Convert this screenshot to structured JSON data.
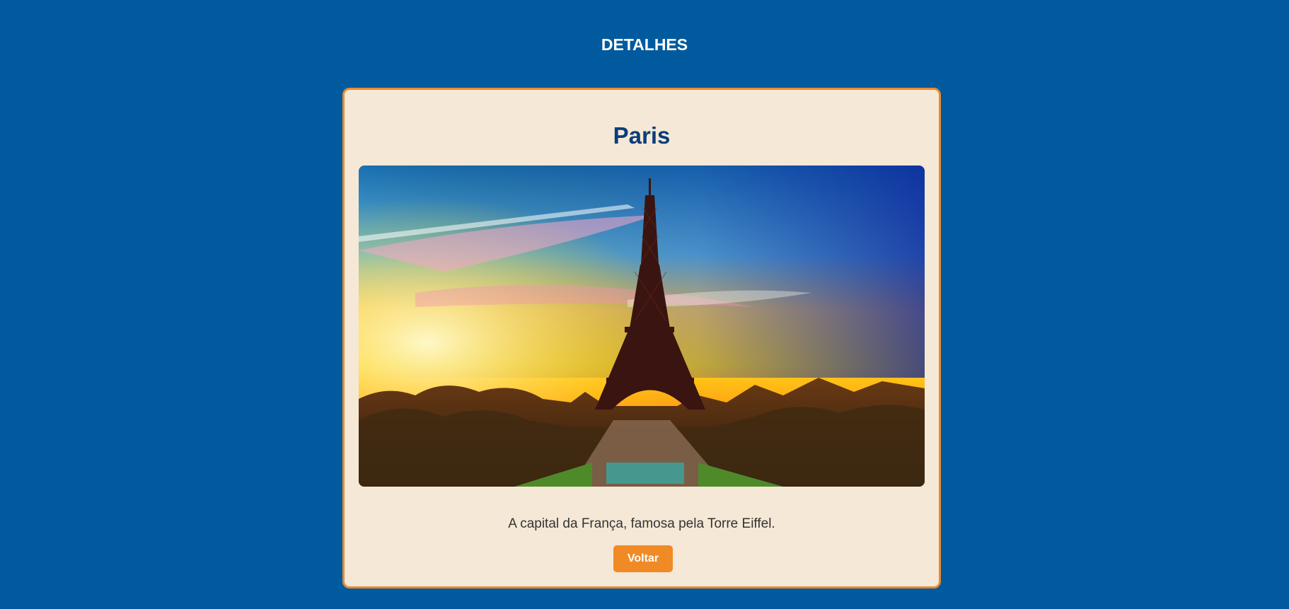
{
  "header": {
    "title": "DETALHES"
  },
  "destination": {
    "name": "Paris",
    "image_alt": "Torre Eiffel",
    "description": "A capital da França, famosa pela Torre Eiffel."
  },
  "actions": {
    "back_label": "Voltar"
  },
  "colors": {
    "page_background": "#015a9e",
    "card_background": "#f5e8d6",
    "card_border": "#e88a2e",
    "title_color": "#0b3d7a",
    "button_background": "#f08a24"
  }
}
